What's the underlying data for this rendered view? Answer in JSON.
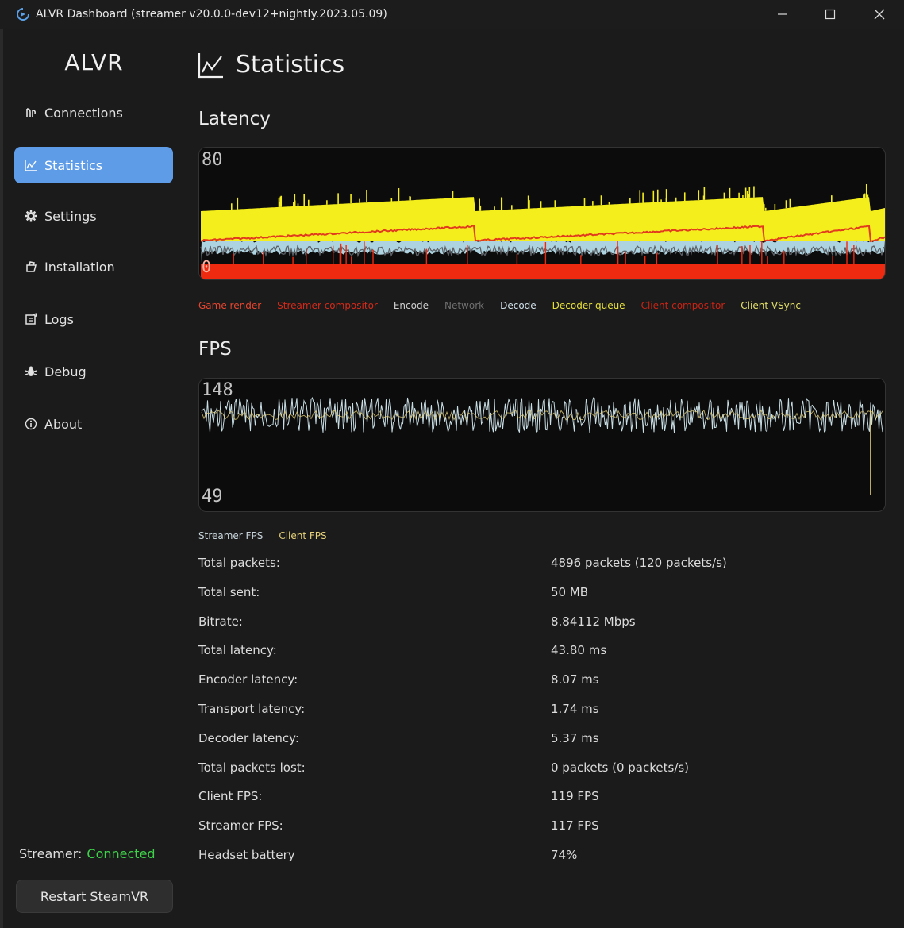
{
  "window": {
    "title": "ALVR Dashboard (streamer v20.0.0-dev12+nightly.2023.05.09)"
  },
  "sidebar": {
    "brand": "ALVR",
    "items": [
      {
        "label": "Connections",
        "icon": "connections-icon"
      },
      {
        "label": "Statistics",
        "icon": "statistics-icon",
        "active": true
      },
      {
        "label": "Settings",
        "icon": "gear-icon"
      },
      {
        "label": "Installation",
        "icon": "installation-icon"
      },
      {
        "label": "Logs",
        "icon": "logs-icon"
      },
      {
        "label": "Debug",
        "icon": "bug-icon"
      },
      {
        "label": "About",
        "icon": "info-icon"
      }
    ],
    "status_label": "Streamer:",
    "status_value": "Connected",
    "restart_label": "Restart SteamVR"
  },
  "main": {
    "title": "Statistics",
    "latency": {
      "heading": "Latency",
      "top_label": "80",
      "bottom_label": "0",
      "legend": [
        {
          "label": "Game render",
          "color": "#e8462f"
        },
        {
          "label": "Streamer compositor",
          "color": "#d42a1a"
        },
        {
          "label": "Encode",
          "color": "#cfcfcf"
        },
        {
          "label": "Network",
          "color": "#6f6f6f"
        },
        {
          "label": "Decode",
          "color": "#cfe0e8"
        },
        {
          "label": "Decoder queue",
          "color": "#e7e03a"
        },
        {
          "label": "Client compositor",
          "color": "#c82415"
        },
        {
          "label": "Client VSync",
          "color": "#e3e06a"
        }
      ]
    },
    "fps": {
      "heading": "FPS",
      "top_label": "148",
      "bottom_label": "49",
      "legend": [
        {
          "label": "Streamer FPS",
          "color": "#c9d6dc"
        },
        {
          "label": "Client FPS",
          "color": "#e6d27a"
        }
      ]
    },
    "stats": [
      {
        "label": "Total packets:",
        "value": "4896 packets (120 packets/s)"
      },
      {
        "label": "Total sent:",
        "value": "50 MB"
      },
      {
        "label": "Bitrate:",
        "value": "8.84112 Mbps"
      },
      {
        "label": "Total latency:",
        "value": "43.80 ms"
      },
      {
        "label": "Encoder latency:",
        "value": "8.07 ms"
      },
      {
        "label": "Transport latency:",
        "value": "1.74 ms"
      },
      {
        "label": "Decoder latency:",
        "value": "5.37 ms"
      },
      {
        "label": "Total packets lost:",
        "value": "0 packets (0 packets/s)"
      },
      {
        "label": "Client FPS:",
        "value": "119 FPS"
      },
      {
        "label": "Streamer FPS:",
        "value": "117 FPS"
      },
      {
        "label": "Headset battery",
        "value": "74%"
      }
    ]
  }
}
